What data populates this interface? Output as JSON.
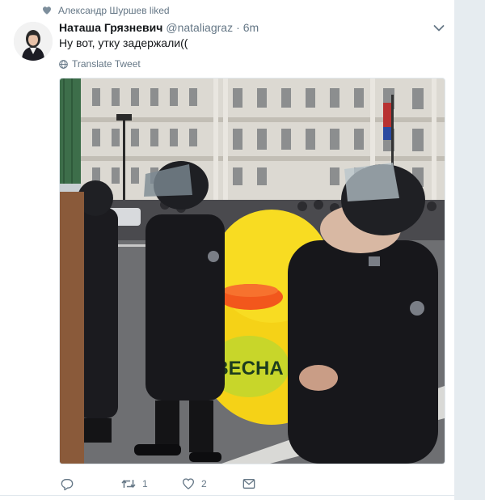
{
  "social_context": {
    "text": "Александр Шуршев liked",
    "icon": "heart-icon"
  },
  "tweet": {
    "author_name": "Наташа Грязневич",
    "author_handle": "@nataliagraz",
    "separator": "·",
    "time": "6m",
    "text": "Ну вот, утку задержали((",
    "translate_label": "Translate Tweet"
  },
  "photo": {
    "duck_label": "ВЕСНА"
  },
  "actions": {
    "reply_count": "",
    "retweet_count": "1",
    "like_count": "2"
  },
  "colors": {
    "secondary_text": "#657786",
    "link_blue": "#1da1f2",
    "card_background": "#ffffff",
    "page_background": "#e6ecf0"
  }
}
